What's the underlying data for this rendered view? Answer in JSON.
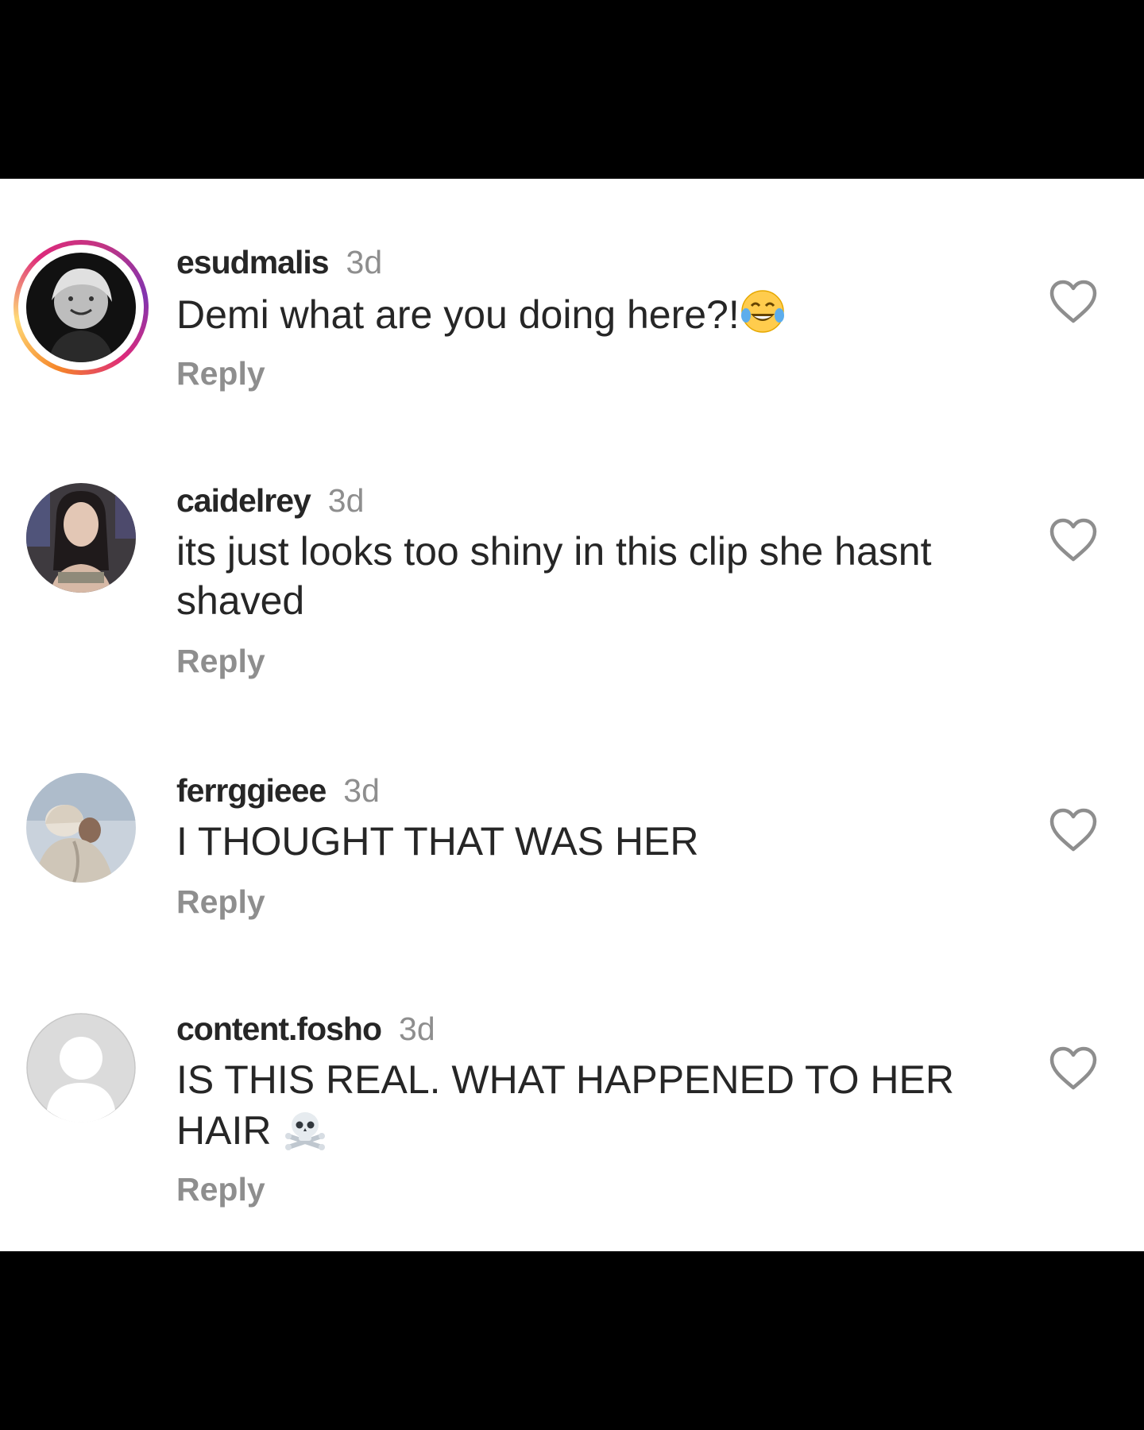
{
  "comments": [
    {
      "username": "esudmalis",
      "time": "3d",
      "text": "Demi what are you doing here?!",
      "emoji": "face-with-tears-of-joy",
      "reply": "Reply",
      "avatar": "profile-photo-monochrome",
      "story_ring": true
    },
    {
      "username": "caidelrey",
      "time": "3d",
      "text": "its just looks too shiny in this clip she hasnt shaved",
      "reply": "Reply",
      "avatar": "profile-photo"
    },
    {
      "username": "ferrggieee",
      "time": "3d",
      "text": "I THOUGHT THAT WAS HER",
      "reply": "Reply",
      "avatar": "profile-photo-winter"
    },
    {
      "username": "content.fosho",
      "time": "3d",
      "text": "IS THIS REAL. WHAT HAPPENED TO HER HAIR",
      "emoji": "skull-and-crossbones",
      "reply": "Reply",
      "avatar": "default-avatar"
    }
  ],
  "colors": {
    "text": "#262626",
    "secondary": "#8e8e8e",
    "background": "#ffffff",
    "frame": "#000000"
  }
}
